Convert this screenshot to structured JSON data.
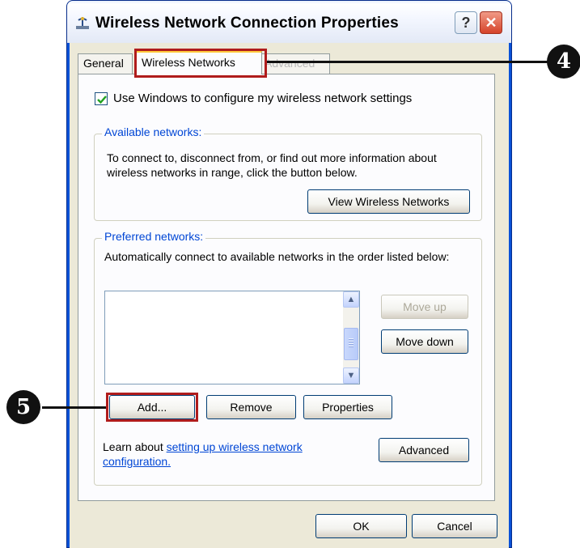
{
  "window": {
    "title": "Wireless Network Connection Properties",
    "help_label": "?",
    "close_label": "✕"
  },
  "tabs": [
    {
      "label": "General"
    },
    {
      "label": "Wireless Networks",
      "selected": true
    },
    {
      "label": "Advanced"
    }
  ],
  "use_windows_checkbox": {
    "label": "Use Windows to configure my wireless network settings",
    "checked": true
  },
  "available_networks": {
    "legend": "Available networks:",
    "description": "To connect to, disconnect from, or find out more information about wireless networks in range, click the button below.",
    "view_button": "View Wireless Networks"
  },
  "preferred_networks": {
    "legend": "Preferred networks:",
    "description": "Automatically connect to available networks in the order listed below:",
    "items": [],
    "move_up": "Move up",
    "move_down": "Move down",
    "add": "Add...",
    "remove": "Remove",
    "properties": "Properties"
  },
  "learn": {
    "prefix": "Learn about ",
    "link": "setting up wireless network configuration."
  },
  "advanced_button": "Advanced",
  "ok_button": "OK",
  "cancel_button": "Cancel",
  "callouts": {
    "tab_marker": "4",
    "add_marker": "5"
  },
  "colors": {
    "callout": "#b01c1c",
    "titlebar_blue": "#0a52d8",
    "link": "#0046d5",
    "dialog_bg": "#ece9d8"
  }
}
